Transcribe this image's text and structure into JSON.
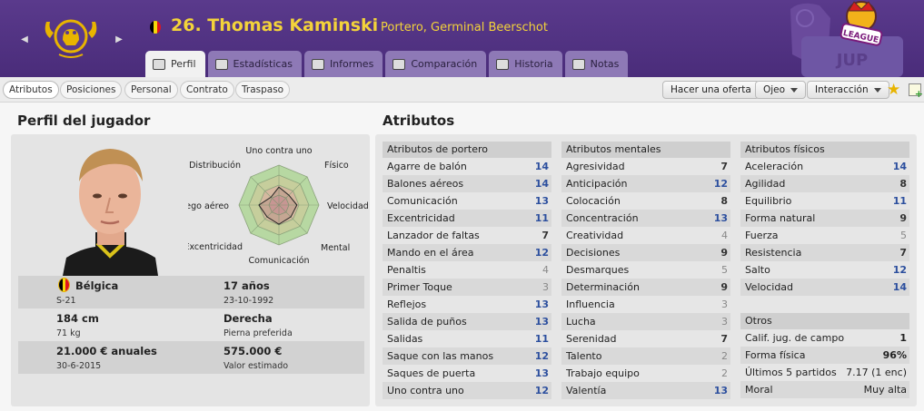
{
  "header": {
    "player_number_name": "26. Thomas Kaminski",
    "position_club": "Portero, Germinal Beerschot",
    "nationality_flag_colors": [
      "#000000",
      "#f5d90a",
      "#e0141e"
    ],
    "league_logo_text": "LEAGUE"
  },
  "tabs": [
    {
      "label": "Perfil",
      "icon": "profile-icon",
      "active": true
    },
    {
      "label": "Estadísticas",
      "icon": "bar-chart-icon",
      "active": false
    },
    {
      "label": "Informes",
      "icon": "report-icon",
      "active": false
    },
    {
      "label": "Comparación",
      "icon": "compare-icon",
      "active": false
    },
    {
      "label": "Historia",
      "icon": "history-icon",
      "active": false
    },
    {
      "label": "Notas",
      "icon": "notes-icon",
      "active": false
    }
  ],
  "subtabs": [
    "Atributos",
    "Posiciones",
    "Personal",
    "Contrato",
    "Traspaso"
  ],
  "actions": {
    "offer": "Hacer una oferta",
    "scout": "Ojeo",
    "interaction": "Interacción"
  },
  "profile": {
    "title": "Perfil del jugador",
    "radar_labels": [
      "Uno contra uno",
      "Físico",
      "Velocidad",
      "Mental",
      "Comunicación",
      "Excentricidad",
      "Juego aéreo",
      "Distribución"
    ],
    "info": [
      {
        "a": "Bélgica",
        "a2": "S-21",
        "b": "17 años",
        "b2": "23-10-1992"
      },
      {
        "a": "184 cm",
        "a2": "71 kg",
        "b": "Derecha",
        "b2": "Pierna preferida"
      },
      {
        "a": "21.000 € anuales",
        "a2": "30-6-2015",
        "b": "575.000 €",
        "b2": "Valor estimado"
      }
    ]
  },
  "attributes": {
    "title": "Atributos",
    "goalkeeper": {
      "header": "Atributos de portero",
      "rows": [
        {
          "name": "Agarre de balón",
          "value": "14"
        },
        {
          "name": "Balones aéreos",
          "value": "14"
        },
        {
          "name": "Comunicación",
          "value": "13"
        },
        {
          "name": "Excentricidad",
          "value": "11"
        },
        {
          "name": "Lanzador de faltas",
          "value": "7"
        },
        {
          "name": "Mando en el área",
          "value": "12"
        },
        {
          "name": "Penaltis",
          "value": "4"
        },
        {
          "name": "Primer Toque",
          "value": "3"
        },
        {
          "name": "Reflejos",
          "value": "13"
        },
        {
          "name": "Salida de puños",
          "value": "13"
        },
        {
          "name": "Salidas",
          "value": "11"
        },
        {
          "name": "Saque con las manos",
          "value": "12"
        },
        {
          "name": "Saques de puerta",
          "value": "13"
        },
        {
          "name": "Uno contra uno",
          "value": "12"
        }
      ]
    },
    "mental": {
      "header": "Atributos mentales",
      "rows": [
        {
          "name": "Agresividad",
          "value": "7"
        },
        {
          "name": "Anticipación",
          "value": "12"
        },
        {
          "name": "Colocación",
          "value": "8"
        },
        {
          "name": "Concentración",
          "value": "13"
        },
        {
          "name": "Creatividad",
          "value": "4"
        },
        {
          "name": "Decisiones",
          "value": "9"
        },
        {
          "name": "Desmarques",
          "value": "5"
        },
        {
          "name": "Determinación",
          "value": "9"
        },
        {
          "name": "Influencia",
          "value": "3"
        },
        {
          "name": "Lucha",
          "value": "3"
        },
        {
          "name": "Serenidad",
          "value": "7"
        },
        {
          "name": "Talento",
          "value": "2"
        },
        {
          "name": "Trabajo equipo",
          "value": "2"
        },
        {
          "name": "Valentía",
          "value": "13"
        }
      ]
    },
    "physical": {
      "header": "Atributos físicos",
      "rows": [
        {
          "name": "Aceleración",
          "value": "14"
        },
        {
          "name": "Agilidad",
          "value": "8"
        },
        {
          "name": "Equilibrio",
          "value": "11"
        },
        {
          "name": "Forma natural",
          "value": "9"
        },
        {
          "name": "Fuerza",
          "value": "5"
        },
        {
          "name": "Resistencia",
          "value": "7"
        },
        {
          "name": "Salto",
          "value": "12"
        },
        {
          "name": "Velocidad",
          "value": "14"
        }
      ]
    },
    "other": {
      "header": "Otros",
      "rows": [
        {
          "name": "Calif. jug. de campo",
          "value": "1"
        },
        {
          "name": "Forma física",
          "value": "96%"
        },
        {
          "name": "Últimos 5 partidos",
          "value": "7.17 (1 enc)"
        },
        {
          "name": "Moral",
          "value": "Muy alta"
        }
      ]
    }
  }
}
